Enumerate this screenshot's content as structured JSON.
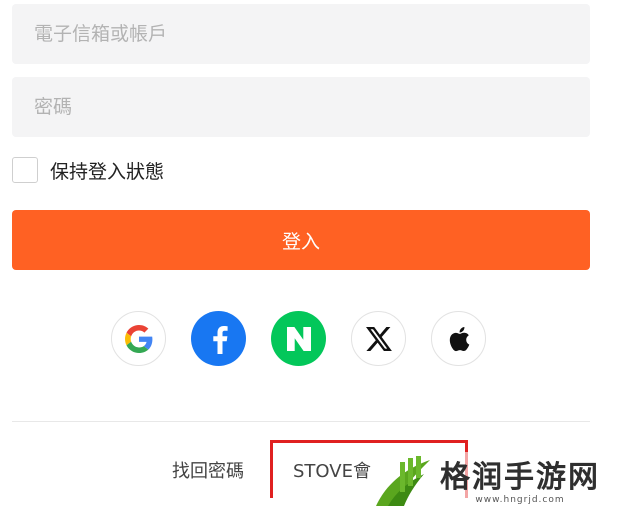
{
  "form": {
    "email_placeholder": "電子信箱或帳戶",
    "password_placeholder": "密碼",
    "remember_label": "保持登入狀態",
    "login_label": "登入"
  },
  "social": [
    {
      "name": "google",
      "icon": "google-icon"
    },
    {
      "name": "facebook",
      "icon": "facebook-icon",
      "color": "#1877f2"
    },
    {
      "name": "naver",
      "icon": "naver-icon",
      "color": "#03c75a"
    },
    {
      "name": "x",
      "icon": "x-icon"
    },
    {
      "name": "apple",
      "icon": "apple-icon"
    }
  ],
  "footer": {
    "find_password": "找回密碼",
    "stove_member": "STOVE會"
  },
  "watermark": {
    "title": "格润手游网",
    "url": "www.hngrjd.com"
  },
  "colors": {
    "accent": "#ff6123",
    "highlight_border": "#e02020"
  }
}
